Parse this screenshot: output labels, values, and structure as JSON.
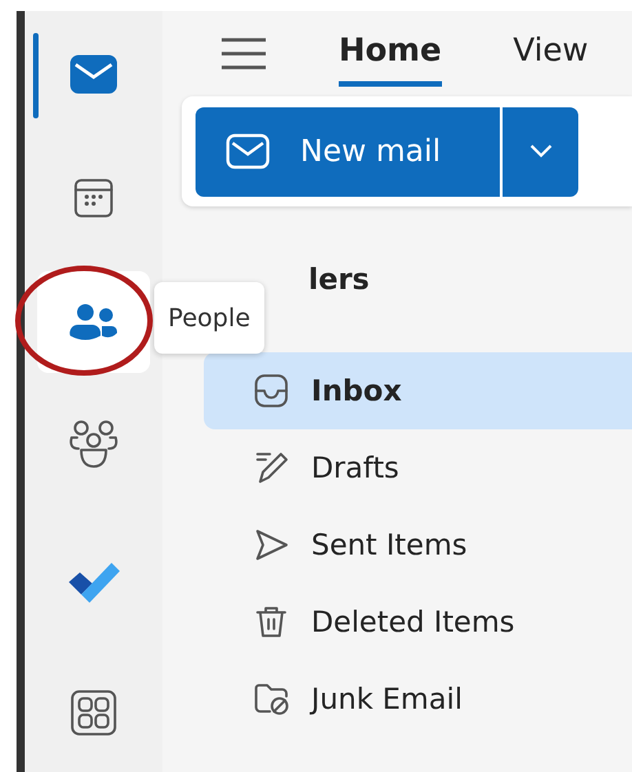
{
  "rail": {
    "items": [
      {
        "kind": "mail",
        "selected": true,
        "hovered": false
      },
      {
        "kind": "calendar",
        "selected": false,
        "hovered": false
      },
      {
        "kind": "people",
        "selected": false,
        "hovered": true
      },
      {
        "kind": "groups",
        "selected": false,
        "hovered": false
      },
      {
        "kind": "todo",
        "selected": false,
        "hovered": false
      },
      {
        "kind": "apps",
        "selected": false,
        "hovered": false
      }
    ],
    "tooltip": "People"
  },
  "tabs": [
    {
      "label": "Home",
      "selected": true
    },
    {
      "label": "View",
      "selected": false
    }
  ],
  "toolbar": {
    "new_mail": "New mail"
  },
  "folders": {
    "heading": "lers",
    "items": [
      {
        "kind": "inbox",
        "label": "Inbox",
        "selected": true
      },
      {
        "kind": "drafts",
        "label": "Drafts",
        "selected": false
      },
      {
        "kind": "sent",
        "label": "Sent Items",
        "selected": false
      },
      {
        "kind": "deleted",
        "label": "Deleted Items",
        "selected": false
      },
      {
        "kind": "junk",
        "label": "Junk Email",
        "selected": false
      }
    ]
  }
}
